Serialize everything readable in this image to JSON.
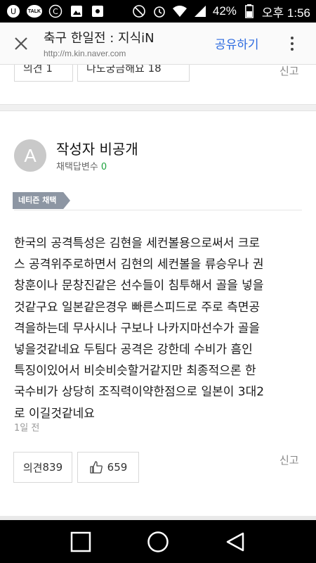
{
  "status_bar": {
    "talk_label": "TALK",
    "battery": "42%",
    "time": "오후 1:56",
    "icons": [
      "u-plus-icon",
      "kakaotalk-icon",
      "c-icon",
      "photo-icon",
      "flower-icon",
      "mute-icon",
      "alarm-icon",
      "wifi-icon",
      "signal-icon",
      "battery-icon"
    ]
  },
  "header": {
    "title": "축구 한일전 : 지식iN",
    "url": "http://m.kin.naver.com",
    "share_label": "공유하기"
  },
  "prev_answer": {
    "opinion_label": "의견 1",
    "question_label": "나도궁금해요 18",
    "report_label": "신고"
  },
  "answer": {
    "avatar_letter": "A",
    "author": "작성자 비공개",
    "adopted_label": "채택답변수",
    "adopted_count": "0",
    "badge": "네티즌 채택",
    "body_lines": [
      "한국의 공격특성은 김현을 세컨볼용으로써서 크로",
      "스 공격위주로하면서 김현의 세컨볼을 류승우나 권",
      "창훈이나 문창진같은 선수들이 침투해서 골을 넣을",
      "것같구요 일본같은경우 빠른스피드로 주로 측면공",
      "격을하는데 무사시나 구보나 나카지마선수가 골을",
      "넣을것같네요 두팀다 공격은 강한데 수비가 흠인",
      "특징이있어서 비슷비슷할거같지만 최종적으론 한",
      "국수비가 상당히 조직력이약한점으로 일본이 3대2",
      "로 이길것같네요"
    ],
    "date": "1일 전",
    "opinion_label": "의견",
    "opinion_count": "839",
    "like_count": "659",
    "report_label": "신고"
  },
  "colors": {
    "accent": "#2d6be0",
    "adopted_count": "#1ea23e",
    "badge": "#8d96a3"
  },
  "navbar": {
    "icons": [
      "recent-apps-icon",
      "home-icon",
      "back-icon"
    ]
  }
}
